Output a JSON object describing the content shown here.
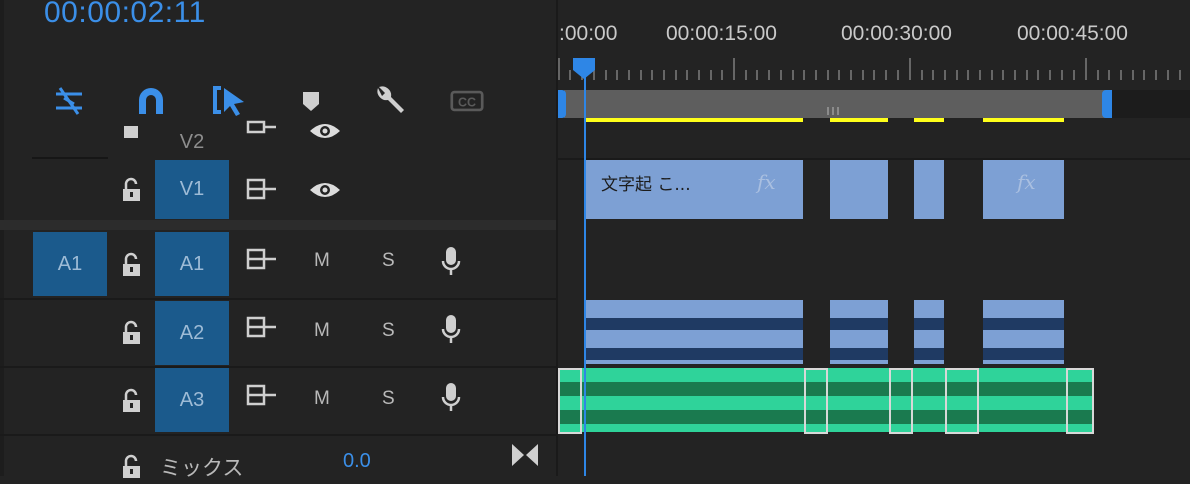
{
  "timecode": "00:00:02:11",
  "ruler": {
    "labels": [
      ":00:00",
      "00:00:15:00",
      "00:00:30:00",
      "00:00:45:00"
    ]
  },
  "tools": [
    {
      "name": "ripple-snap-icon",
      "color": "#3b8fe8"
    },
    {
      "name": "magnet-icon",
      "color": "#3b8fe8"
    },
    {
      "name": "linked-selection-icon",
      "color": "#3b8fe8"
    },
    {
      "name": "marker-icon",
      "color": "#cfcfcf"
    },
    {
      "name": "wrench-icon",
      "color": "#cfcfcf"
    },
    {
      "name": "cc-icon",
      "color": "#5a5a5a"
    }
  ],
  "tracks": {
    "v2": {
      "label": "V2"
    },
    "v1": {
      "label": "V1"
    },
    "a1": {
      "source": "A1",
      "label": "A1",
      "m": "M",
      "s": "S"
    },
    "a2": {
      "label": "A2",
      "m": "M",
      "s": "S"
    },
    "a3": {
      "label": "A3",
      "m": "M",
      "s": "S"
    },
    "mix": {
      "label": "ミックス",
      "value": "0.0"
    }
  },
  "clips": {
    "v1_title": "文字起 こ...",
    "fx": "fx"
  },
  "colors": {
    "accent": "#3b8fe8",
    "patch": "#1b5a8c",
    "video_clip": "#7da0d4",
    "audio_clip": "#7da0d4",
    "green_clip": "#2fd39a",
    "render_bar": "#ffff1a"
  }
}
